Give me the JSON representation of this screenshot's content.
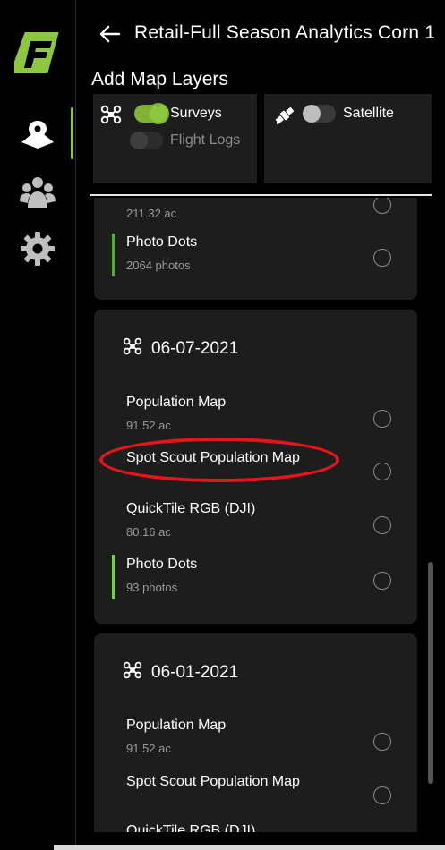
{
  "app": {
    "brand_color": "#8dc63f"
  },
  "header": {
    "title": "Retail-Full Season Analytics Corn 1"
  },
  "section": {
    "title": "Add Map Layers"
  },
  "layer_toggles": {
    "surveys_label": "Surveys",
    "surveys_on": true,
    "flight_logs_label": "Flight Logs",
    "flight_logs_on": false,
    "satellite_label": "Satellite",
    "satellite_on": false
  },
  "flights": [
    {
      "date": "",
      "layers": [
        {
          "title": "",
          "sub": "211.32 ac"
        },
        {
          "title": "Photo Dots",
          "sub": "2064 photos"
        }
      ]
    },
    {
      "date": "06-07-2021",
      "layers": [
        {
          "title": "Population Map",
          "sub": "91.52 ac"
        },
        {
          "title": "Spot Scout Population Map",
          "sub": ""
        },
        {
          "title": "QuickTile RGB (DJI)",
          "sub": "80.16 ac"
        },
        {
          "title": "Photo Dots",
          "sub": "93 photos"
        }
      ]
    },
    {
      "date": "06-01-2021",
      "layers": [
        {
          "title": "Population Map",
          "sub": "91.52 ac"
        },
        {
          "title": "Spot Scout Population Map",
          "sub": ""
        },
        {
          "title": "QuickTile RGB (DJI)",
          "sub": ""
        }
      ]
    }
  ],
  "annotation": {
    "color": "#e8141b"
  }
}
